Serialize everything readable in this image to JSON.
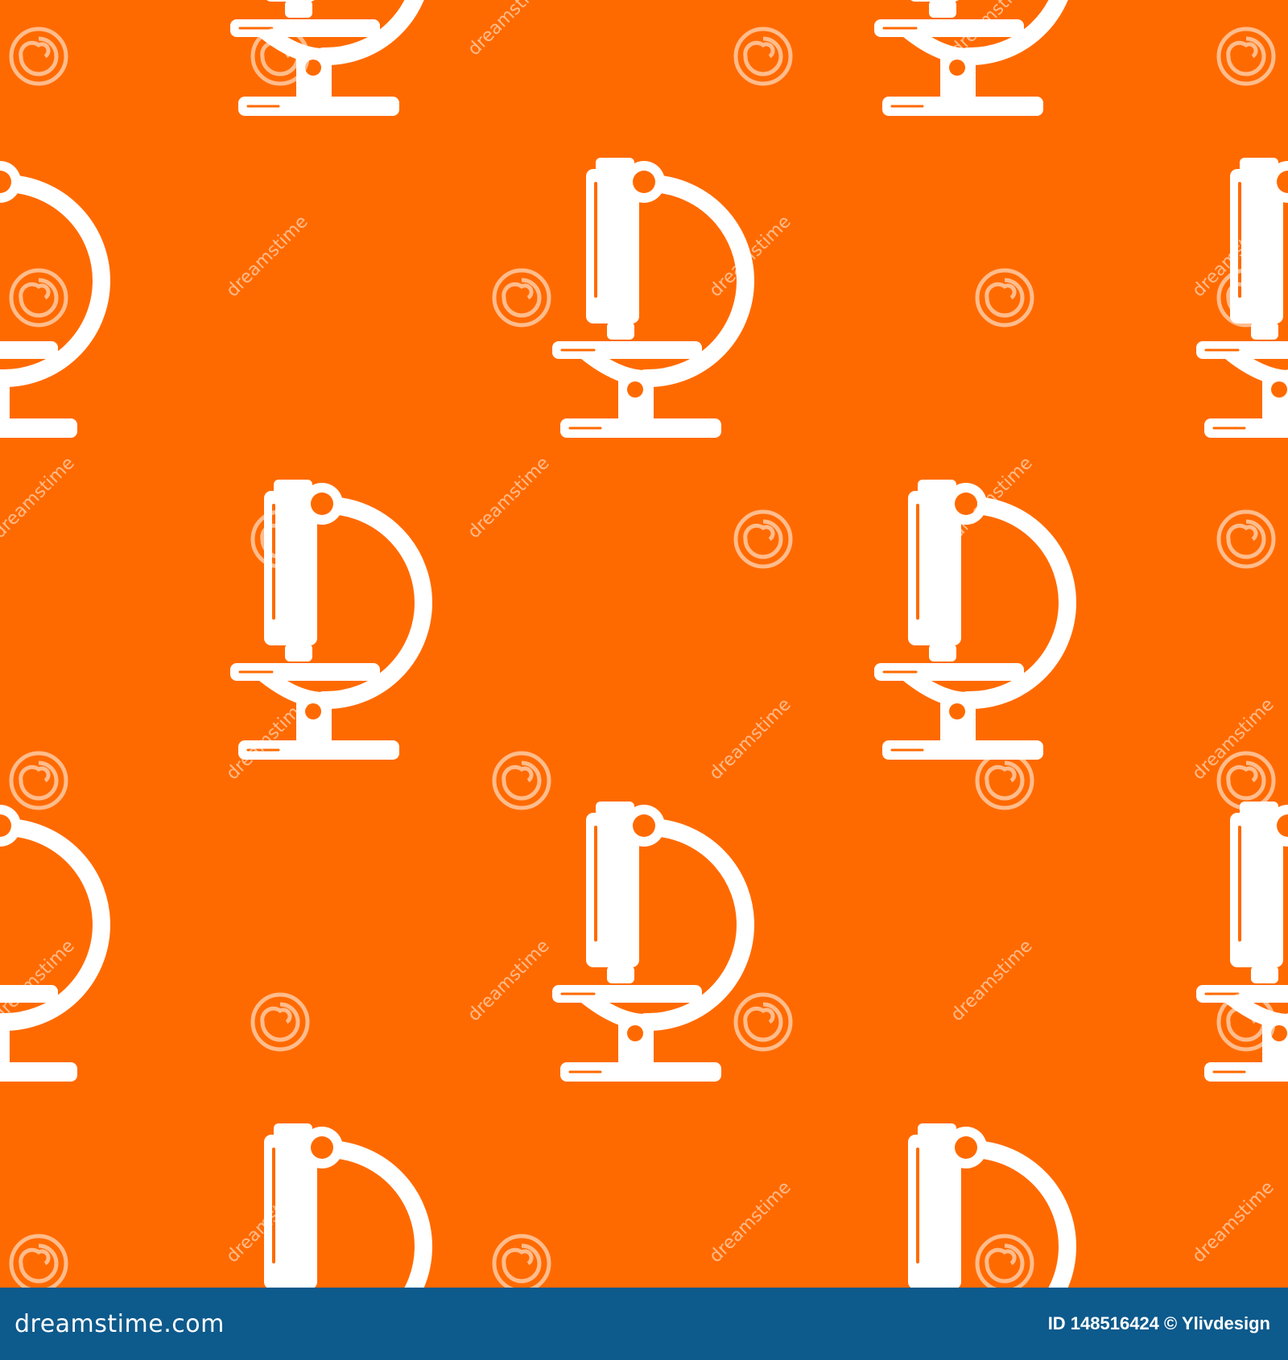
{
  "colors": {
    "background": "#ff6a00",
    "icon": "#ffffff",
    "footer": "#0d5a8c",
    "footer_text": "#ffffff"
  },
  "pattern": {
    "icon_name": "microscope-icon",
    "watermark_logo_text": "dreamstime",
    "watermark_spiral_icon": "dreamstime-spiral-icon"
  },
  "footer": {
    "logo": "dreamstime.com",
    "credit": "ID 148516424 © Ylivdesign"
  }
}
